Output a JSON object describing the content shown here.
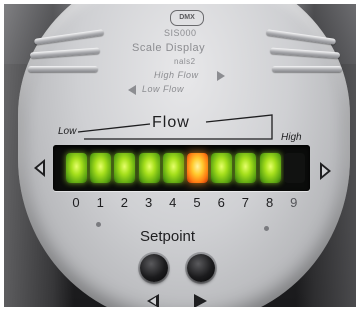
{
  "device": {
    "brand": "DMX",
    "model_line": "SIS000",
    "title_faint": "Scale Display",
    "subtitle_faint": "nals2",
    "upper_right_faint": "High Flow",
    "upper_left_faint": "Low Flow"
  },
  "flow": {
    "title": "Flow",
    "low_label": "Low",
    "high_label": "High"
  },
  "bargraph": {
    "scale": [
      "0",
      "1",
      "2",
      "3",
      "4",
      "5",
      "6",
      "7",
      "8",
      "9"
    ],
    "lit_segments": 9,
    "highlight_index": 5,
    "colors": {
      "green": "#a6e01c",
      "orange": "#ff7a12",
      "off": "#111211"
    }
  },
  "controls": {
    "setpoint_label": "Setpoint",
    "left_button_icon": "triangle-left-icon",
    "right_button_icon": "triangle-right-icon"
  }
}
